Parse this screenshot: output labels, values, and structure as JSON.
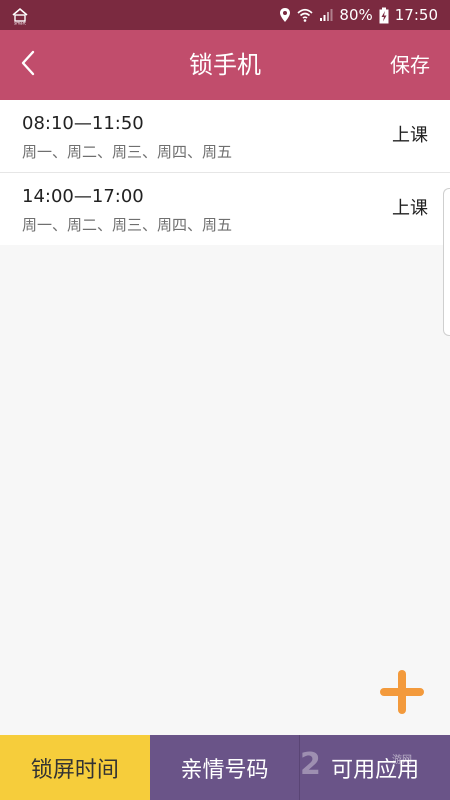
{
  "status_bar": {
    "battery": "80%",
    "time": "17:50",
    "left_icon": "smart-home-icon",
    "icons": [
      "location-icon",
      "wifi-icon",
      "signal-icon",
      "battery-charging-icon"
    ]
  },
  "header": {
    "title": "锁手机",
    "save_label": "保存",
    "back_icon": "back-chevron-icon"
  },
  "schedules": [
    {
      "time": "08:10—11:50",
      "days": "周一、周二、周三、周四、周五",
      "mode": "上课"
    },
    {
      "time": "14:00—17:00",
      "days": "周一、周二、周三、周四、周五",
      "mode": "上课"
    }
  ],
  "add_button": {
    "icon": "plus-icon",
    "color": "#f39a3c"
  },
  "tabs": [
    {
      "label": "锁屏时间",
      "color": "#f6cd3b"
    },
    {
      "label": "亲情号码",
      "color": "#6a5488"
    },
    {
      "label": "可用应用",
      "color": "#6a5488"
    }
  ],
  "watermark": {
    "text": "2",
    "sub": "游网"
  },
  "colors": {
    "status_bar": "#7b2a40",
    "header": "#c14d6c",
    "background": "#f7f7f7"
  }
}
